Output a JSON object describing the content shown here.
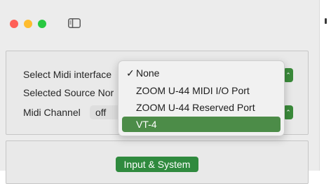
{
  "settings": {
    "select_midi_interface_label": "Select Midi interface",
    "selected_source_label": "Selected Source Nor",
    "midi_channel_label": "Midi Channel",
    "midi_channel_value": "off"
  },
  "midi_interface_menu": {
    "check_mark": "✓",
    "items": [
      {
        "label": "None",
        "checked": true
      },
      {
        "label": "ZOOM U-44 MIDI I/O Port",
        "checked": false
      },
      {
        "label": "ZOOM U-44 Reserved Port",
        "checked": false
      },
      {
        "label": "VT-4",
        "checked": false,
        "highlighted": true
      }
    ]
  },
  "tabs": {
    "input_system_label": "Input & System"
  },
  "colors": {
    "accent_green": "#4c8c48",
    "traffic_red": "#ff5f57",
    "traffic_yellow": "#febc2e",
    "traffic_green": "#28c840"
  },
  "icons": {
    "sidebar_toggle": "sidebar-icon",
    "stepper": "chevron-updown-icon"
  }
}
